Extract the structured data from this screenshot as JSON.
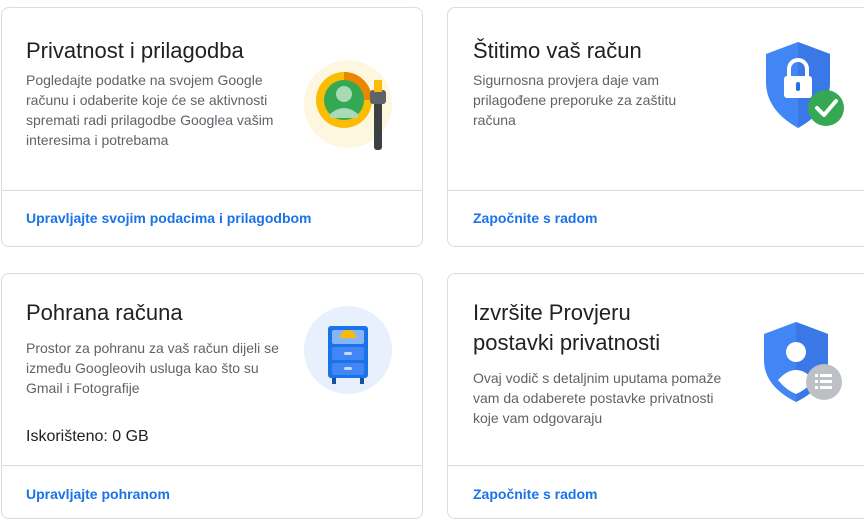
{
  "cards": [
    {
      "title": "Privatnost i prilagodba",
      "description": "Pogledajte podatke na svojem Google računu i odaberite koje će se aktivnosti spremati radi prilagodbe Googlea vašim interesima i potrebama",
      "link": "Upravljajte svojim podacima i prilagodbom",
      "icon": "privacy-personalization-icon"
    },
    {
      "title": "Štitimo vaš račun",
      "description": "Sigurnosna provjera daje vam prilagođene preporuke za zaštitu računa",
      "link": "Započnite s radom",
      "icon": "shield-lock-check-icon"
    },
    {
      "title": "Pohrana računa",
      "description": "Prostor za pohranu za vaš račun dijeli se između Googleovih usluga kao što su Gmail i Fotografije",
      "usage": "Iskorišteno: 0 GB",
      "link": "Upravljajte pohranom",
      "icon": "storage-cabinet-icon"
    },
    {
      "title": "Izvršite Provjeru postavki privatnosti",
      "description": "Ovaj vodič s detaljnim uputama pomaže vam da odaberete postavke privatnosti koje vam odgovaraju",
      "link": "Započnite s radom",
      "icon": "privacy-checkup-icon"
    }
  ],
  "colors": {
    "link": "#1a73e8",
    "border": "#dadce0",
    "text_secondary": "#5f6368",
    "google_blue": "#4285f4",
    "google_green": "#34a853",
    "google_yellow": "#fbbc04"
  }
}
